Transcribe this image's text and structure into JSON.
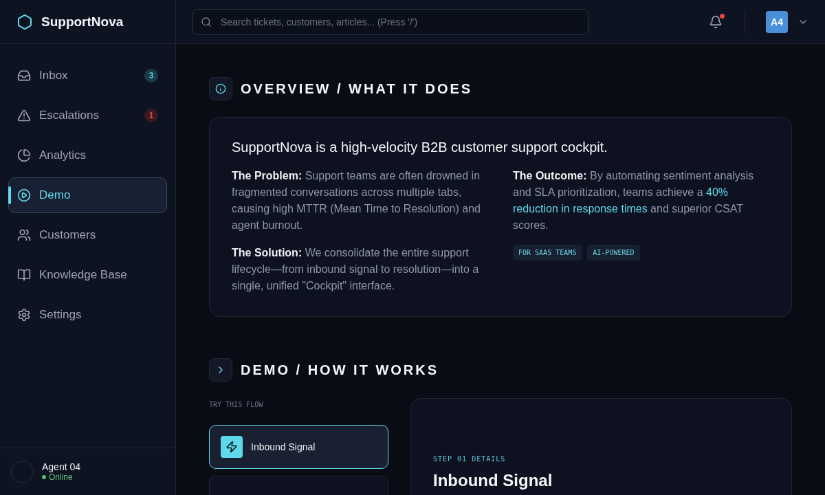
{
  "brand": {
    "name": "SupportNova"
  },
  "search": {
    "placeholder": "Search tickets, customers, articles... (Press '/')"
  },
  "header": {
    "notifications": {
      "unread": true
    },
    "avatar": {
      "initials": "A4"
    }
  },
  "sidebar": {
    "items": [
      {
        "label": "Inbox",
        "selected": false,
        "badge": {
          "text": "3",
          "kind": "info"
        }
      },
      {
        "label": "Escalations",
        "selected": false,
        "badge": {
          "text": "1",
          "kind": "alert"
        }
      },
      {
        "label": "Analytics",
        "selected": false
      },
      {
        "label": "Demo",
        "selected": true
      },
      {
        "label": "Customers",
        "selected": false
      },
      {
        "label": "Knowledge Base",
        "selected": false
      },
      {
        "label": "Settings",
        "selected": false
      }
    ],
    "user": {
      "name": "Agent 04",
      "status": "Online",
      "online": true
    }
  },
  "overview": {
    "heading": "OVERVIEW / WHAT IT DOES",
    "headline": "SupportNova is a high-velocity B2B customer support cockpit.",
    "left": [
      {
        "parts": [
          {
            "kind": "text",
            "text": "**The Problem:** Support teams are often drowned in fragmented conversations across multiple tabs, causing high MTTR (Mean Time to Resolution) and agent burnout."
          }
        ]
      },
      {
        "parts": [
          {
            "kind": "text",
            "text": "**The Solution:** We consolidate the entire support lifecycle—from inbound signal to resolution—into a single, unified \"Cockpit\" interface."
          }
        ]
      }
    ],
    "right": [
      {
        "parts": [
          {
            "kind": "text",
            "text": "**The Outcome:** By automating sentiment analysis and SLA prioritization, teams achieve a "
          },
          {
            "kind": "highlight",
            "text": "40% reduction in response times"
          },
          {
            "kind": "text",
            "text": " and superior CSAT scores."
          }
        ]
      }
    ],
    "tags": [
      "FOR SAAS TEAMS",
      "AI-POWERED"
    ]
  },
  "demo": {
    "heading": "DEMO / HOW IT WORKS",
    "flow_label": "TRY THIS FLOW",
    "steps": [
      {
        "label": "Inbound Signal",
        "selected": true
      },
      {
        "selected": false
      }
    ],
    "detail": {
      "step_label": "STEP 01 DETAILS",
      "title": "Inbound Signal"
    }
  }
}
